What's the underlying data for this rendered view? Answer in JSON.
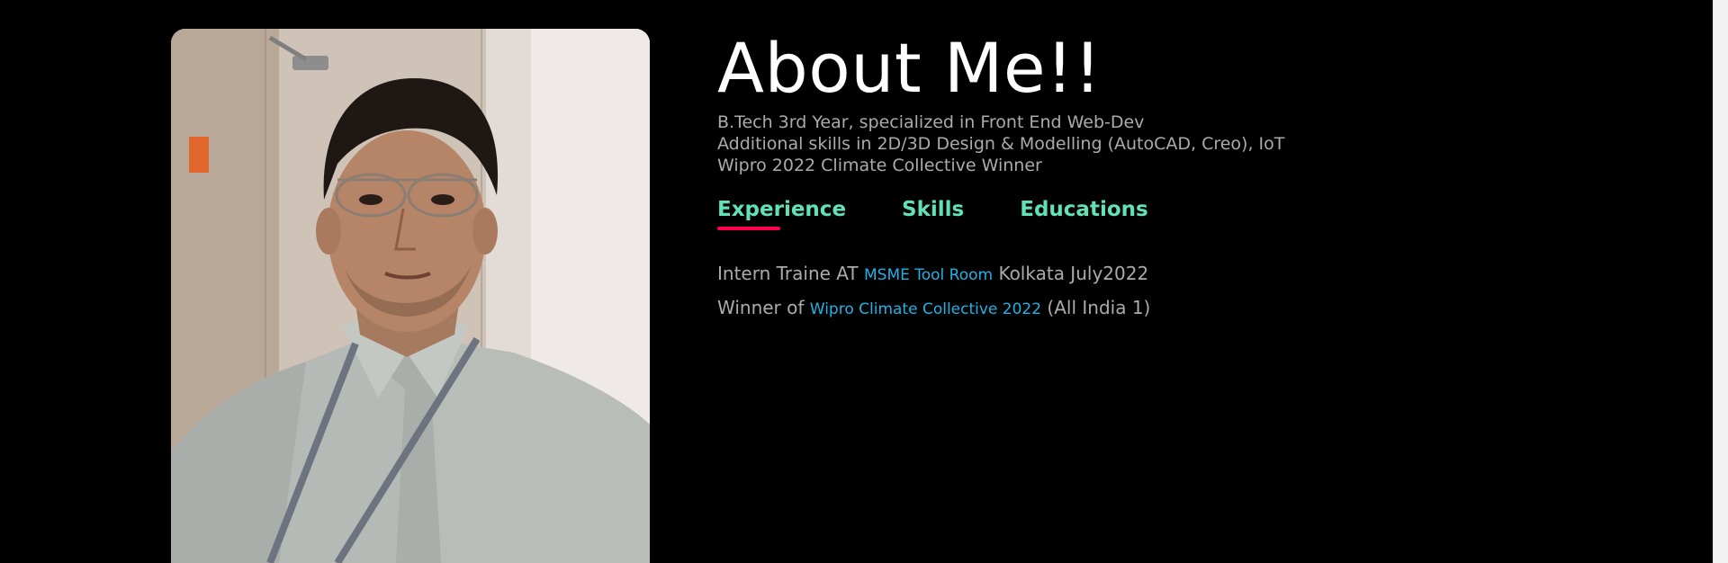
{
  "photo": {
    "alt": "Profile photo"
  },
  "about": {
    "title": "About Me!!",
    "lines": [
      "B.Tech 3rd Year, specialized in Front End Web-Dev",
      "Additional skills in 2D/3D Design & Modelling (AutoCAD, Creo), IoT",
      "Wipro 2022 Climate Collective Winner"
    ]
  },
  "tabs": {
    "items": [
      {
        "label": "Experience",
        "active": true
      },
      {
        "label": "Skills",
        "active": false
      },
      {
        "label": "Educations",
        "active": false
      }
    ],
    "active_color": "#61e1b7",
    "underline_color": "#ff004f"
  },
  "experience": [
    {
      "before": "Intern Traine AT",
      "highlight": "MSME Tool Room",
      "after": "Kolkata July2022"
    },
    {
      "before": "Winner of",
      "highlight": "Wipro Climate Collective 2022",
      "after": "(All India 1)"
    }
  ],
  "colors": {
    "background": "#000000",
    "title": "#ffffff",
    "text": "#ababab",
    "highlight": "#1fb2e6"
  }
}
